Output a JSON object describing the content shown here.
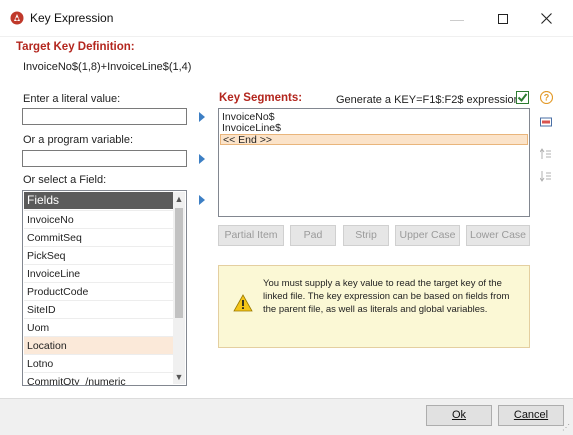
{
  "window": {
    "title": "Key Expression"
  },
  "target": {
    "heading": "Target Key Definition:",
    "expression": "InvoiceNo$(1,8)+InvoiceLine$(1,4)"
  },
  "inputs": {
    "literal_label": "Enter a literal value:",
    "literal_value": "",
    "variable_label": "Or a program variable:",
    "variable_value": "",
    "field_label": "Or select a Field:"
  },
  "fields_list": {
    "header": "Fields",
    "items": [
      "InvoiceNo",
      "CommitSeq",
      "PickSeq",
      "InvoiceLine",
      "ProductCode",
      "SiteID",
      "Uom",
      "Location",
      "Lotno",
      "CommitQty_/numeric"
    ],
    "selected": "Location"
  },
  "segments": {
    "heading": "Key Segments:",
    "generate_label": "Generate a KEY=F1$:F2$ expression",
    "generate_checked": true,
    "items": [
      "InvoiceNo$",
      "InvoiceLine$",
      "<< End >>"
    ],
    "selected": "<< End >>"
  },
  "tools": {
    "partial_item": "Partial Item",
    "pad": "Pad",
    "strip": "Strip",
    "upper_case": "Upper Case",
    "lower_case": "Lower Case"
  },
  "message": "You must supply a key value to read the target key of the linked file. The key expression can be based on fields from the parent file, as well as literals and global variables.",
  "buttons": {
    "ok": "Ok",
    "cancel": "Cancel"
  },
  "colors": {
    "heading_red": "#b3261e",
    "selected_row": "#fbe9d9",
    "message_bg": "#fbf8d5",
    "check_green": "#2e7d32",
    "arrow_blue": "#3d7fc4"
  }
}
